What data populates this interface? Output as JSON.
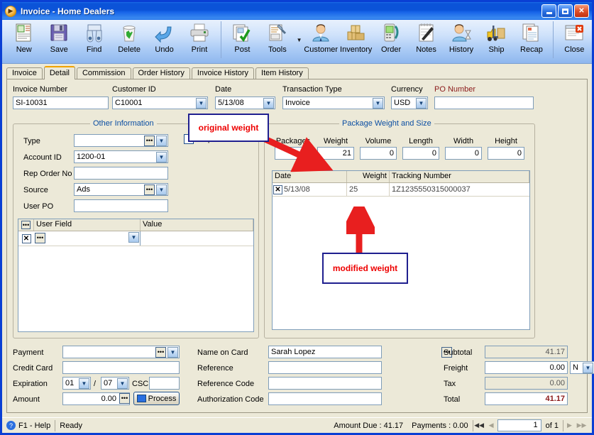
{
  "window": {
    "title": "Invoice  -  Home Dealers",
    "icon": "app-play-icon",
    "buttons": {
      "minimize": "_",
      "maximize": "□",
      "close": "✕"
    }
  },
  "toolbar": {
    "items": [
      {
        "label": "New",
        "icon": "new-document-icon"
      },
      {
        "label": "Save",
        "icon": "floppy-disk-icon"
      },
      {
        "label": "Find",
        "icon": "binoculars-icon"
      },
      {
        "label": "Delete",
        "icon": "recycle-bin-icon"
      },
      {
        "label": "Undo",
        "icon": "undo-arrow-icon"
      },
      {
        "label": "Print",
        "icon": "printer-icon"
      },
      {
        "label": "Post",
        "icon": "post-checkmark-icon"
      },
      {
        "label": "Tools",
        "icon": "tools-wrench-icon"
      },
      {
        "label": "Customer",
        "icon": "customer-person-icon"
      },
      {
        "label": "Inventory",
        "icon": "boxes-icon"
      },
      {
        "label": "Order",
        "icon": "order-phone-icon"
      },
      {
        "label": "Notes",
        "icon": "notepad-pen-icon"
      },
      {
        "label": "History",
        "icon": "history-hourglass-icon"
      },
      {
        "label": "Ship",
        "icon": "forklift-icon"
      },
      {
        "label": "Recap",
        "icon": "recap-pages-icon"
      },
      {
        "label": "Close",
        "icon": "close-window-icon"
      }
    ]
  },
  "tabs": [
    {
      "label": "Invoice",
      "active": false
    },
    {
      "label": "Detail",
      "active": true
    },
    {
      "label": "Commission",
      "active": false
    },
    {
      "label": "Order History",
      "active": false
    },
    {
      "label": "Invoice History",
      "active": false
    },
    {
      "label": "Item History",
      "active": false
    }
  ],
  "header_fields": {
    "invoice_number": {
      "label": "Invoice Number",
      "value": "SI-10031"
    },
    "customer_id": {
      "label": "Customer ID",
      "value": "C10001"
    },
    "date": {
      "label": "Date",
      "value": "5/13/08"
    },
    "transaction_type": {
      "label": "Transaction Type",
      "value": "Invoice"
    },
    "currency": {
      "label": "Currency",
      "value": "USD"
    },
    "po_number": {
      "label": "PO Number",
      "value": ""
    }
  },
  "other_information": {
    "title": "Other Information",
    "type": {
      "label": "Type",
      "value": ""
    },
    "account_id": {
      "label": "Account ID",
      "value": "1200-01"
    },
    "rep_order_no": {
      "label": "Rep Order No",
      "value": ""
    },
    "source": {
      "label": "Source",
      "value": "Ads"
    },
    "user_po": {
      "label": "User PO",
      "value": ""
    },
    "ship_blind": {
      "label": "Ship Blind",
      "checked": false
    },
    "user_fields_grid": {
      "columns": [
        "User Field",
        "Value"
      ],
      "rows": [
        {
          "user_field": "",
          "value": ""
        }
      ]
    }
  },
  "package_weight_and_size": {
    "title": "Package Weight and Size",
    "fields": [
      {
        "label": "Packages",
        "value": "1"
      },
      {
        "label": "Weight",
        "value": "21"
      },
      {
        "label": "Volume",
        "value": "0"
      },
      {
        "label": "Length",
        "value": "0"
      },
      {
        "label": "Width",
        "value": "0"
      },
      {
        "label": "Height",
        "value": "0"
      }
    ],
    "grid": {
      "columns": [
        "Date",
        "Weight",
        "Tracking Number"
      ],
      "rows": [
        {
          "date": "5/13/08",
          "weight": "25",
          "tracking_number": "1Z1235550315000037"
        }
      ]
    }
  },
  "payment": {
    "payment": {
      "label": "Payment",
      "value": ""
    },
    "credit_card": {
      "label": "Credit Card",
      "value": ""
    },
    "expiration": {
      "label": "Expiration",
      "month": "01",
      "separator": "/",
      "year": "07"
    },
    "csc": {
      "label": "CSC",
      "value": ""
    },
    "amount": {
      "label": "Amount",
      "value": "0.00"
    },
    "process_button": "Process"
  },
  "card_details": {
    "name_on_card": {
      "label": "Name on Card",
      "value": "Sarah  Lopez"
    },
    "reference": {
      "label": "Reference",
      "value": ""
    },
    "reference_code": {
      "label": "Reference Code",
      "value": ""
    },
    "authorization_code": {
      "label": "Authorization Code",
      "value": ""
    }
  },
  "totals": {
    "subtotal": {
      "label": "Subtotal",
      "value": "41.17"
    },
    "freight": {
      "label": "Freight",
      "value": "0.00",
      "taxable": "N"
    },
    "tax": {
      "label": "Tax",
      "value": "0.00"
    },
    "total": {
      "label": "Total",
      "value": "41.17"
    }
  },
  "status_bar": {
    "help": "F1 - Help",
    "state": "Ready",
    "amount_due": "Amount Due : 41.17",
    "payments": "Payments : 0.00",
    "page_current": "1",
    "page_of": "of  1",
    "nav": {
      "first": "◀◀",
      "prev": "◀",
      "next": "▶",
      "last": "▶▶"
    }
  },
  "annotations": [
    {
      "text": "original weight",
      "target": "weight-field"
    },
    {
      "text": "modified weight",
      "target": "grid-weight-cell"
    }
  ],
  "colors": {
    "accent_blue": "#0b53d8",
    "group_title": "#0b4ea2",
    "annotation_text": "#ee0000",
    "annotation_border": "#1f1f8f",
    "arrow": "#e81f1f",
    "total_value": "#8b1a1a",
    "window_bg": "#ECE9D8"
  }
}
